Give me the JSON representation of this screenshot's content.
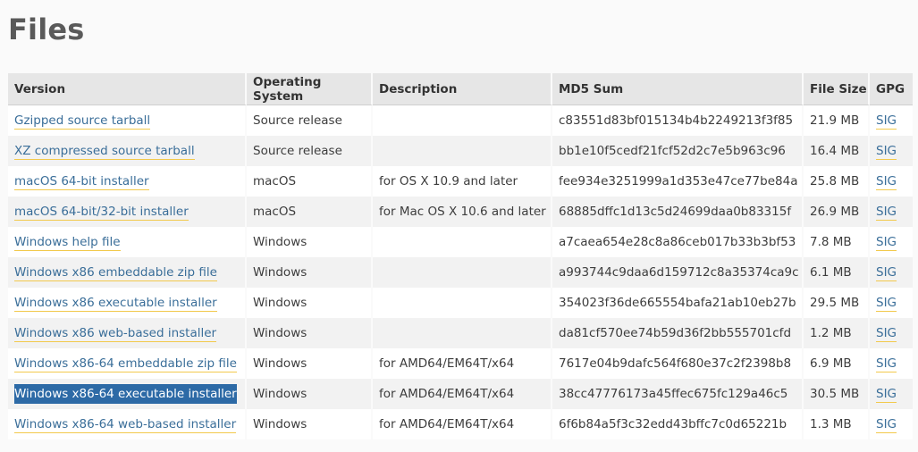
{
  "page": {
    "title": "Files"
  },
  "table": {
    "headers": [
      "Version",
      "Operating System",
      "Description",
      "MD5 Sum",
      "File Size",
      "GPG"
    ],
    "rows": [
      {
        "version": "Gzipped source tarball",
        "os": "Source release",
        "description": "",
        "md5": "c83551d83bf015134b4b2249213f3f85",
        "size": "21.9 MB",
        "gpg": "SIG"
      },
      {
        "version": "XZ compressed source tarball",
        "os": "Source release",
        "description": "",
        "md5": "bb1e10f5cedf21fcf52d2c7e5b963c96",
        "size": "16.4 MB",
        "gpg": "SIG"
      },
      {
        "version": "macOS 64-bit installer",
        "os": "macOS",
        "description": "for OS X 10.9 and later",
        "md5": "fee934e3251999a1d353e47ce77be84a",
        "size": "25.8 MB",
        "gpg": "SIG"
      },
      {
        "version": "macOS 64-bit/32-bit installer",
        "os": "macOS",
        "description": "for Mac OS X 10.6 and later",
        "md5": "68885dffc1d13c5d24699daa0b83315f",
        "size": "26.9 MB",
        "gpg": "SIG"
      },
      {
        "version": "Windows help file",
        "os": "Windows",
        "description": "",
        "md5": "a7caea654e28c8a86ceb017b33b3bf53",
        "size": "7.8 MB",
        "gpg": "SIG"
      },
      {
        "version": "Windows x86 embeddable zip file",
        "os": "Windows",
        "description": "",
        "md5": "a993744c9daa6d159712c8a35374ca9c",
        "size": "6.1 MB",
        "gpg": "SIG"
      },
      {
        "version": "Windows x86 executable installer",
        "os": "Windows",
        "description": "",
        "md5": "354023f36de665554bafa21ab10eb27b",
        "size": "29.5 MB",
        "gpg": "SIG"
      },
      {
        "version": "Windows x86 web-based installer",
        "os": "Windows",
        "description": "",
        "md5": "da81cf570ee74b59d36f2bb555701cfd",
        "size": "1.2 MB",
        "gpg": "SIG"
      },
      {
        "version": "Windows x86-64 embeddable zip file",
        "os": "Windows",
        "description": "for AMD64/EM64T/x64",
        "md5": "7617e04b9dafc564f680e37c2f2398b8",
        "size": "6.9 MB",
        "gpg": "SIG"
      },
      {
        "version": "Windows x86-64 executable installer",
        "os": "Windows",
        "description": "for AMD64/EM64T/x64",
        "md5": "38cc47776173a45ffec675fc129a46c5",
        "size": "30.5 MB",
        "gpg": "SIG",
        "selected": true
      },
      {
        "version": "Windows x86-64 web-based installer",
        "os": "Windows",
        "description": "for AMD64/EM64T/x64",
        "md5": "6f6b84a5f3c32edd43bffc7c0d65221b",
        "size": "1.3 MB",
        "gpg": "SIG"
      }
    ]
  },
  "colors": {
    "link": "#3a6e99",
    "link_underline": "#f2c94c",
    "selection_bg": "#2d6aa6",
    "header_bg": "#e6e6e6",
    "row_alt_bg": "#f2f2f2"
  }
}
